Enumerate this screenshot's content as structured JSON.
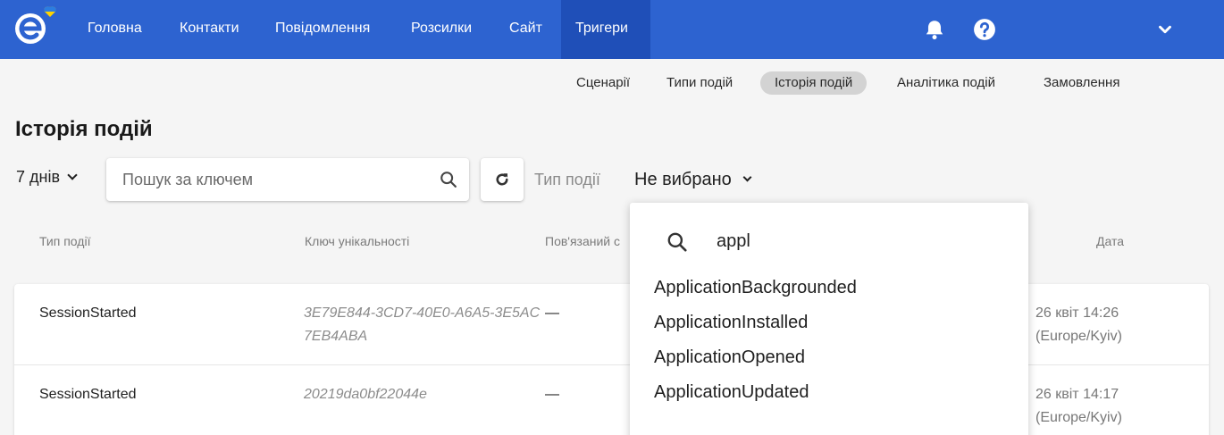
{
  "nav": {
    "items": [
      "Головна",
      "Контакти",
      "Повідомлення",
      "Розсилки",
      "Сайт",
      "Тригери"
    ],
    "active": "Тригери"
  },
  "subnav": {
    "items": [
      "Сценарії",
      "Типи подій",
      "Історія подій",
      "Аналітика подій",
      "Замовлення"
    ],
    "active": "Історія подій"
  },
  "page": {
    "title": "Історія подій"
  },
  "filters": {
    "period": "7 днів",
    "search_placeholder": "Пошук за ключем",
    "event_type_label": "Тип події",
    "event_type_value": "Не вибрано"
  },
  "table": {
    "headers": {
      "type": "Тип події",
      "key": "Ключ унікальності",
      "related": "Пов'язаний с",
      "date": "Дата"
    },
    "rows": [
      {
        "type": "SessionStarted",
        "key": "3E79E844-3CD7-40E0-A6A5-3E5AC7EB4ABA",
        "related": "—",
        "date": "26 квіт 14:26",
        "tz": "(Europe/Kyiv)"
      },
      {
        "type": "SessionStarted",
        "key": "20219da0bf22044e",
        "related": "—",
        "date": "26 квіт 14:17",
        "tz": "(Europe/Kyiv)"
      }
    ]
  },
  "dropdown": {
    "query": "appl",
    "options": [
      "ApplicationBackgrounded",
      "ApplicationInstalled",
      "ApplicationOpened",
      "ApplicationUpdated"
    ]
  },
  "colors": {
    "brand": "#2d63d0",
    "brand_active": "#1f4fb8",
    "logo_accent": "#ffd400"
  },
  "icons": [
    "logo-e",
    "bell-icon",
    "help-icon",
    "chevron-down-icon",
    "search-icon",
    "refresh-icon"
  ]
}
